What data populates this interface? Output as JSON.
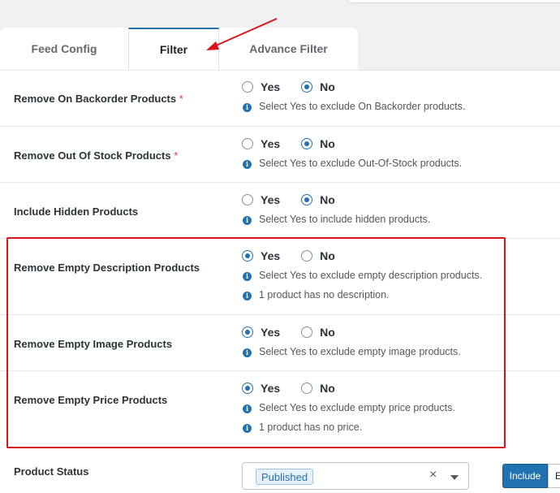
{
  "tabs": [
    {
      "label": "Feed Config"
    },
    {
      "label": "Filter"
    },
    {
      "label": "Advance Filter"
    }
  ],
  "active_tab": "Filter",
  "radio_labels": {
    "yes": "Yes",
    "no": "No"
  },
  "settings": [
    {
      "label": "Remove On Backorder Products",
      "required": "*",
      "selected": "No",
      "hints": [
        "Select Yes to exclude On Backorder products."
      ]
    },
    {
      "label": "Remove Out Of Stock Products",
      "required": "*",
      "selected": "No",
      "hints": [
        "Select Yes to exclude Out-Of-Stock products."
      ]
    },
    {
      "label": "Include Hidden Products",
      "required": "",
      "selected": "No",
      "hints": [
        "Select Yes to include hidden products."
      ]
    },
    {
      "label": "Remove Empty Description Products",
      "required": "",
      "selected": "Yes",
      "hints": [
        "Select Yes to exclude empty description products.",
        "1 product has no description."
      ]
    },
    {
      "label": "Remove Empty Image Products",
      "required": "",
      "selected": "Yes",
      "hints": [
        "Select Yes to exclude empty image products."
      ]
    },
    {
      "label": "Remove Empty Price Products",
      "required": "",
      "selected": "Yes",
      "hints": [
        "Select Yes to exclude empty price products.",
        "1 product has no price."
      ]
    }
  ],
  "product_status": {
    "label": "Product Status",
    "selected_chip": "Published",
    "include_label": "Include",
    "exclude_label": "E"
  },
  "info_icon_glyph": "i",
  "colors": {
    "accent": "#2271b1",
    "annotation_red": "#d9131b"
  }
}
